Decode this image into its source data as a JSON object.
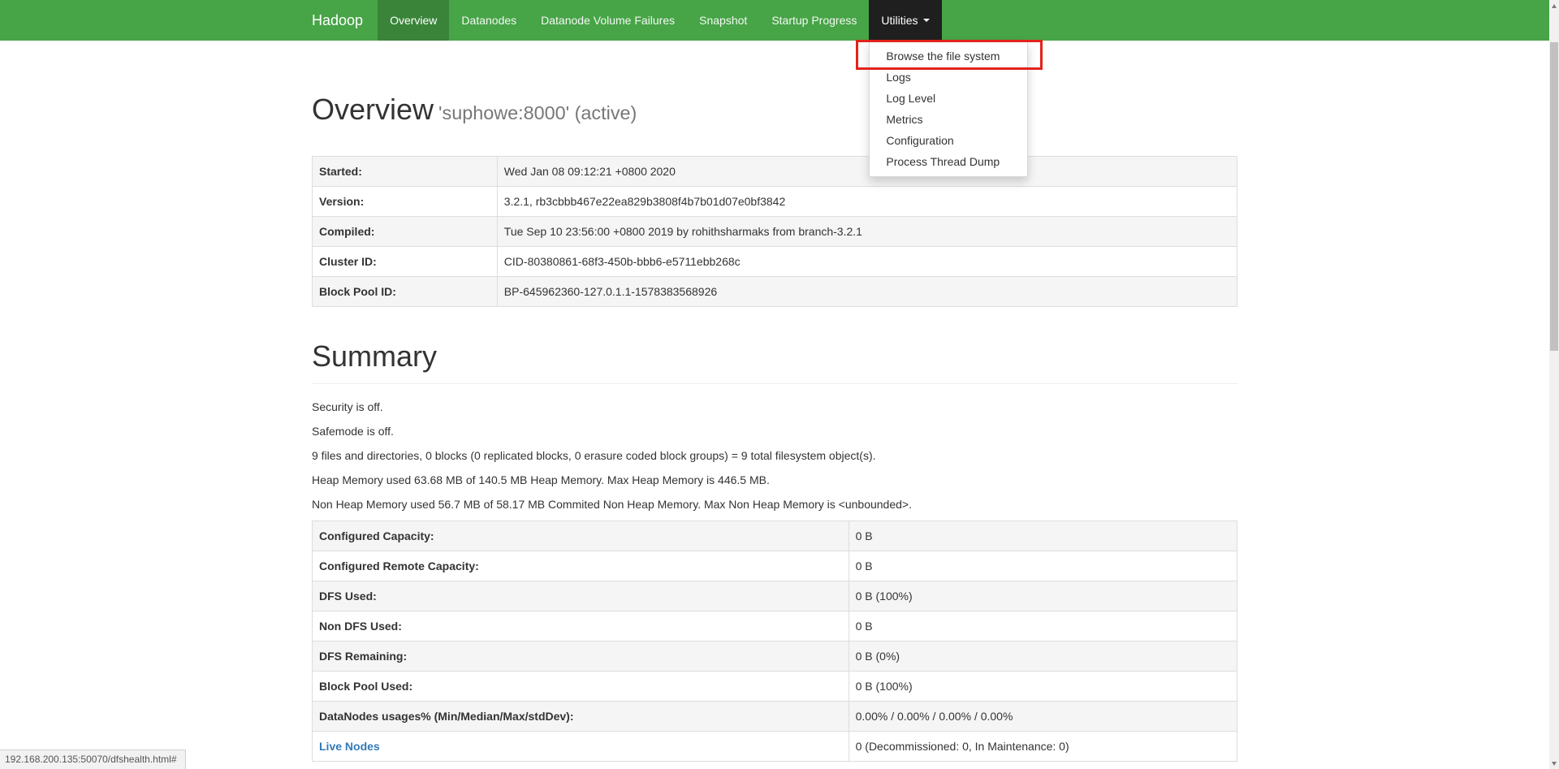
{
  "navbar": {
    "brand": "Hadoop",
    "items": [
      {
        "label": "Overview",
        "active": true
      },
      {
        "label": "Datanodes"
      },
      {
        "label": "Datanode Volume Failures"
      },
      {
        "label": "Snapshot"
      },
      {
        "label": "Startup Progress"
      },
      {
        "label": "Utilities",
        "dropdown": true,
        "open": true
      }
    ],
    "utilities_menu": [
      "Browse the file system",
      "Logs",
      "Log Level",
      "Metrics",
      "Configuration",
      "Process Thread Dump"
    ]
  },
  "page": {
    "title": "Overview",
    "subtitle": "'suphowe:8000' (active)"
  },
  "overview_table": {
    "rows": [
      {
        "label": "Started:",
        "value": "Wed Jan 08 09:12:21 +0800 2020"
      },
      {
        "label": "Version:",
        "value": "3.2.1, rb3cbbb467e22ea829b3808f4b7b01d07e0bf3842"
      },
      {
        "label": "Compiled:",
        "value": "Tue Sep 10 23:56:00 +0800 2019 by rohithsharmaks from branch-3.2.1"
      },
      {
        "label": "Cluster ID:",
        "value": "CID-80380861-68f3-450b-bbb6-e5711ebb268c"
      },
      {
        "label": "Block Pool ID:",
        "value": "BP-645962360-127.0.1.1-1578383568926"
      }
    ]
  },
  "summary": {
    "heading": "Summary",
    "paragraphs": [
      "Security is off.",
      "Safemode is off.",
      "9 files and directories, 0 blocks (0 replicated blocks, 0 erasure coded block groups) = 9 total filesystem object(s).",
      "Heap Memory used 63.68 MB of 140.5 MB Heap Memory. Max Heap Memory is 446.5 MB.",
      "Non Heap Memory used 56.7 MB of 58.17 MB Commited Non Heap Memory. Max Non Heap Memory is <unbounded>."
    ],
    "table": {
      "rows": [
        {
          "label": "Configured Capacity:",
          "value": "0 B"
        },
        {
          "label": "Configured Remote Capacity:",
          "value": "0 B"
        },
        {
          "label": "DFS Used:",
          "value": "0 B (100%)"
        },
        {
          "label": "Non DFS Used:",
          "value": "0 B"
        },
        {
          "label": "DFS Remaining:",
          "value": "0 B (0%)"
        },
        {
          "label": "Block Pool Used:",
          "value": "0 B (100%)"
        },
        {
          "label": "DataNodes usages% (Min/Median/Max/stdDev):",
          "value": "0.00% / 0.00% / 0.00% / 0.00%"
        },
        {
          "label": "Live Nodes",
          "value": "0 (Decommissioned: 0, In Maintenance: 0)",
          "link": true
        }
      ]
    }
  },
  "status_bar": {
    "text": "192.168.200.135:50070/dfshealth.html#"
  },
  "colors": {
    "navbar_green": "#47a447",
    "active_item_green": "#398439",
    "open_item_dark": "#1f1f1f",
    "annotation_red": "#e2231a",
    "link_blue": "#337ab7",
    "stripe_gray": "#f5f5f5",
    "border_gray": "#dddddd"
  }
}
